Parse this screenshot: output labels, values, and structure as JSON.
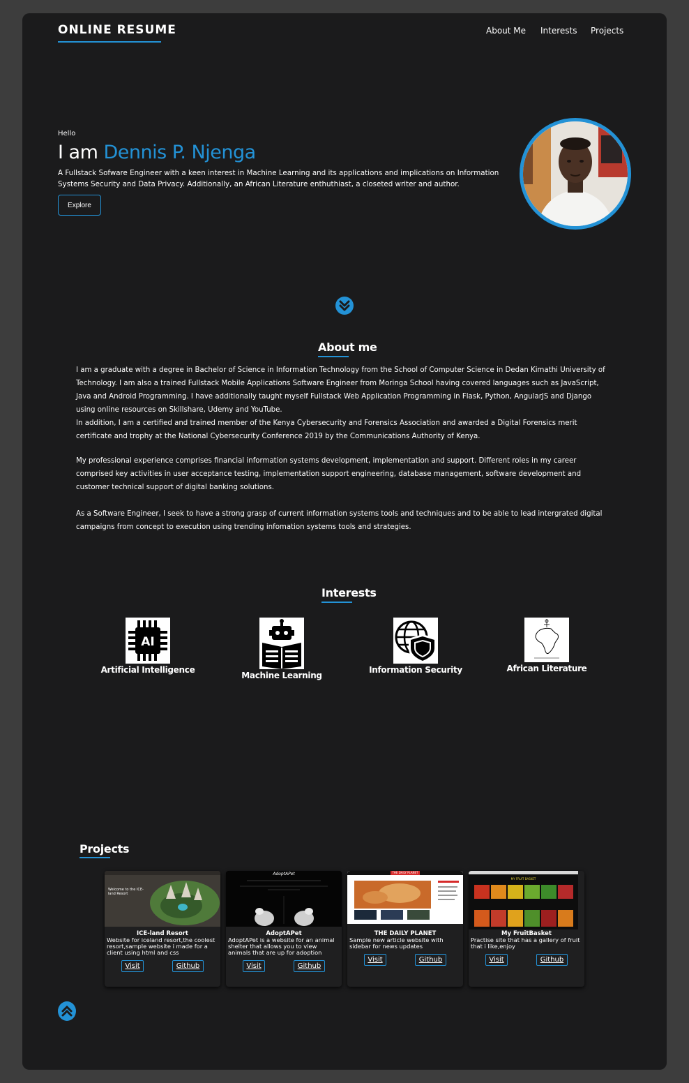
{
  "header": {
    "brand": "ONLINE RESUME",
    "nav": [
      "About Me",
      "Interests",
      "Projects"
    ]
  },
  "hero": {
    "greeting": "Hello",
    "intro_prefix": "I am",
    "name": "Dennis P. Njenga",
    "description": "A Fullstack Sofware Engineer with a keen interest in Machine Learning and its applications and implications on Information Systems Security and Data Privacy. Additionally, an African Literature enthuthiast, a closeted writer and author.",
    "explore_label": "Explore"
  },
  "about": {
    "title": "About me",
    "paragraphs": [
      "I am a graduate with a degree in Bachelor of Science in Information Technology from the School of Computer Science in Dedan Kimathi University of Technology. I am also a trained Fullstack Mobile Applications Software Engineer from Moringa School having covered languages such as JavaScript, Java and Android Programming. I have additionally taught myself Fullstack Web Application Programming in Flask, Python, AngularJS and Django using online resources on Skillshare, Udemy and YouTube.",
      "In addition, I am a certified and trained member of the Kenya Cybersecurity and Forensics Association and awarded a Digital Forensics merit certificate and trophy at the National Cybersecurity Conference 2019 by the Communications Authority of Kenya.",
      "My professional experience comprises financial information systems development, implementation and support. Different roles in my career comprised key activities in user acceptance testing, implementation support engineering, database management, software development and customer technical support of digital banking solutions.",
      "As a Software Engineer, I seek to have a strong grasp of current information systems tools and techniques and to be able to lead intergrated digital campaigns from concept to execution using trending infomation systems tools and strategies."
    ]
  },
  "interests": {
    "title": "Interests",
    "items": [
      {
        "label": "Artificial Intelligence",
        "icon": "ai-chip-icon",
        "icon_text": "AI"
      },
      {
        "label": "Machine Learning",
        "icon": "robot-reading-icon"
      },
      {
        "label": "Information Security",
        "icon": "globe-shield-icon"
      },
      {
        "label": "African Literature",
        "icon": "africa-map-icon"
      }
    ]
  },
  "projects": {
    "title": "Projects",
    "items": [
      {
        "title": "ICE-land Resort",
        "description": "Website for iceland resort,the coolest resort,sample website i made for a client using html and css",
        "visit": "Visit",
        "github": "Github",
        "thumb_heading": "Welcome to the ICE-land Resort"
      },
      {
        "title": "AdoptAPet",
        "description": "AdoptAPet is a website for an animal shelter that allows you to view animals that are up for adoption",
        "visit": "Visit",
        "github": "Github",
        "thumb_heading": "AdoptAPet"
      },
      {
        "title": "THE DAILY PLANET",
        "description": "Sample new article website with sidebar for news updates",
        "visit": "Visit",
        "github": "Github",
        "thumb_heading": "THE DAILY PLANET"
      },
      {
        "title": "My FruitBasket",
        "description": "Practise site that has a gallery of fruit that i like,enjoy",
        "visit": "Visit",
        "github": "Github",
        "thumb_heading": "MY FRUIT BASKET"
      }
    ]
  },
  "colors": {
    "accent": "#2392d6",
    "card": "#1b1b1c",
    "page": "#3d3d3d"
  }
}
